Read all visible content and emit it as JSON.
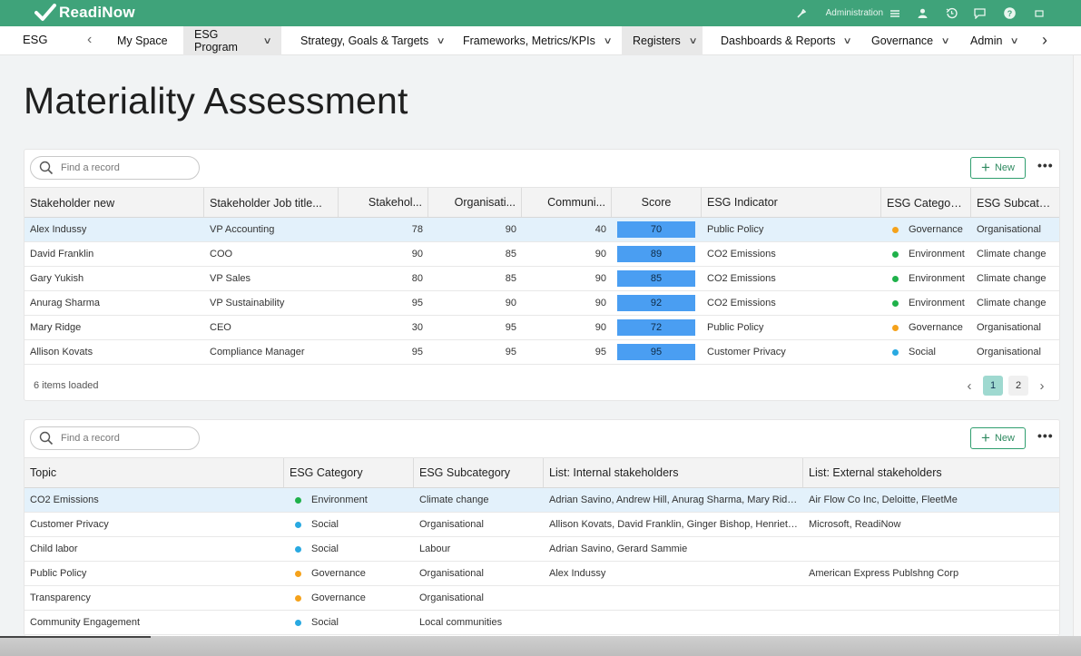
{
  "app": {
    "logo": "ReadiNow",
    "admin_label": "Administration"
  },
  "nav": {
    "app_name": "ESG",
    "items": [
      {
        "label": "My Space",
        "has_menu": false
      },
      {
        "label": "ESG Program",
        "has_menu": true,
        "active": true
      },
      {
        "label": "Strategy, Goals & Targets",
        "has_menu": true
      },
      {
        "label": "Frameworks, Metrics/KPIs",
        "has_menu": true
      },
      {
        "label": "Registers",
        "has_menu": true,
        "active": true
      },
      {
        "label": "Dashboards & Reports",
        "has_menu": true
      },
      {
        "label": "Governance",
        "has_menu": true
      },
      {
        "label": "Admin",
        "has_menu": true
      }
    ]
  },
  "page": {
    "title": "Materiality Assessment"
  },
  "colors": {
    "brand": "#3fa37a",
    "environment": "#1fb14a",
    "governance": "#f5a21b",
    "social": "#29a9e1",
    "score": "#4a9ef2"
  },
  "grid1": {
    "search_placeholder": "Find a record",
    "new_label": "New",
    "more_label": "•••",
    "columns": [
      "Stakeholder new",
      "Stakeholder Job title...",
      "Stakehol...",
      "Organisati...",
      "Communi...",
      "Score",
      "ESG Indicator",
      "ESG Category...",
      "ESG Subcateg..."
    ],
    "rows": [
      {
        "name": "Alex Indussy",
        "title": "VP Accounting",
        "stake": "78",
        "org": "90",
        "comm": "40",
        "score": "70",
        "indicator": "Public Policy",
        "category": "Governance",
        "cat_color": "#f5a21b",
        "subcat": "Organisational",
        "selected": true
      },
      {
        "name": "David Franklin",
        "title": "COO",
        "stake": "90",
        "org": "85",
        "comm": "90",
        "score": "89",
        "indicator": "CO2 Emissions",
        "category": "Environment",
        "cat_color": "#1fb14a",
        "subcat": "Climate change"
      },
      {
        "name": "Gary Yukish",
        "title": "VP Sales",
        "stake": "80",
        "org": "85",
        "comm": "90",
        "score": "85",
        "indicator": "CO2 Emissions",
        "category": "Environment",
        "cat_color": "#1fb14a",
        "subcat": "Climate change"
      },
      {
        "name": "Anurag Sharma",
        "title": "VP Sustainability",
        "stake": "95",
        "org": "90",
        "comm": "90",
        "score": "92",
        "indicator": "CO2 Emissions",
        "category": "Environment",
        "cat_color": "#1fb14a",
        "subcat": "Climate change"
      },
      {
        "name": "Mary Ridge",
        "title": "CEO",
        "stake": "30",
        "org": "95",
        "comm": "90",
        "score": "72",
        "indicator": "Public Policy",
        "category": "Governance",
        "cat_color": "#f5a21b",
        "subcat": "Organisational"
      },
      {
        "name": "Allison Kovats",
        "title": "Compliance Manager",
        "stake": "95",
        "org": "95",
        "comm": "95",
        "score": "95",
        "indicator": "Customer Privacy",
        "category": "Social",
        "cat_color": "#29a9e1",
        "subcat": "Organisational"
      }
    ],
    "items_loaded": "6 items loaded",
    "pages": [
      "1",
      "2"
    ],
    "current_page": "1"
  },
  "grid2": {
    "search_placeholder": "Find a record",
    "new_label": "New",
    "more_label": "•••",
    "columns": [
      "Topic",
      "ESG Category",
      "ESG Subcategory",
      "List: Internal stakeholders",
      "List: External stakeholders"
    ],
    "rows": [
      {
        "topic": "CO2 Emissions",
        "category": "Environment",
        "cat_color": "#1fb14a",
        "subcat": "Climate change",
        "internal": "Adrian Savino, Andrew Hill, Anurag Sharma, Mary Ridge, S...",
        "external": "Air Flow Co Inc, Deloitte, FleetMe",
        "selected": true
      },
      {
        "topic": "Customer Privacy",
        "category": "Social",
        "cat_color": "#29a9e1",
        "subcat": "Organisational",
        "internal": "Allison Kovats, David Franklin, Ginger Bishop, Henrietta Ma...",
        "external": "Microsoft, ReadiNow"
      },
      {
        "topic": "Child labor",
        "category": "Social",
        "cat_color": "#29a9e1",
        "subcat": "Labour",
        "internal": "Adrian Savino, Gerard Sammie",
        "external": ""
      },
      {
        "topic": "Public Policy",
        "category": "Governance",
        "cat_color": "#f5a21b",
        "subcat": "Organisational",
        "internal": "Alex Indussy",
        "external": "American Express Publshng Corp"
      },
      {
        "topic": "Transparency",
        "category": "Governance",
        "cat_color": "#f5a21b",
        "subcat": "Organisational",
        "internal": "",
        "external": ""
      },
      {
        "topic": "Community Engagement",
        "category": "Social",
        "cat_color": "#29a9e1",
        "subcat": "Local communities",
        "internal": "",
        "external": ""
      }
    ]
  }
}
